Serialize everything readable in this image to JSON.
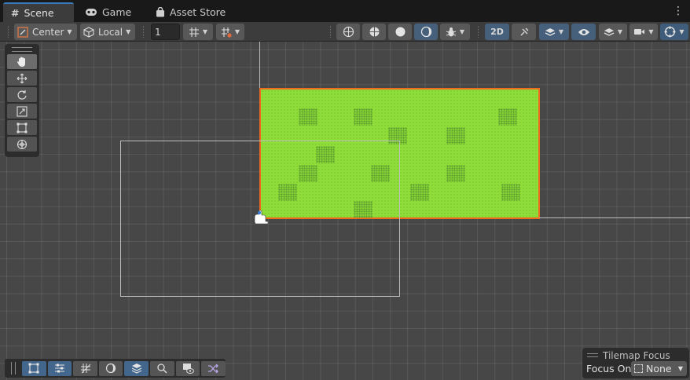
{
  "tabs": [
    {
      "label": "Scene",
      "icon": "grid-hash-icon",
      "active": true
    },
    {
      "label": "Game",
      "icon": "gamepad-icon",
      "active": false
    },
    {
      "label": "Asset Store",
      "icon": "shopping-bag-icon",
      "active": false
    }
  ],
  "toolbar": {
    "pivot_mode": "Center",
    "pivot_rotation": "Local",
    "grid_snap_value": "1",
    "view_mode_2d": "2D"
  },
  "scene": {
    "tilemap_color": "#8fdd3b",
    "selection_outline_color": "#f06a1e",
    "camera_frame_color": "#bdbdbd"
  },
  "tools": [
    "hand-tool",
    "move-tool",
    "rotate-tool",
    "scale-tool",
    "rect-tool",
    "transform-tool"
  ],
  "tilemap_toolbar": [
    "select-tool",
    "move-tool",
    "paint-brush-tool",
    "box-fill-tool",
    "pick-tool",
    "eraser-tool",
    "fill-tool",
    "palette-tool"
  ],
  "tilemap_focus": {
    "title": "Tilemap Focus",
    "label": "Focus On",
    "value": "None"
  }
}
